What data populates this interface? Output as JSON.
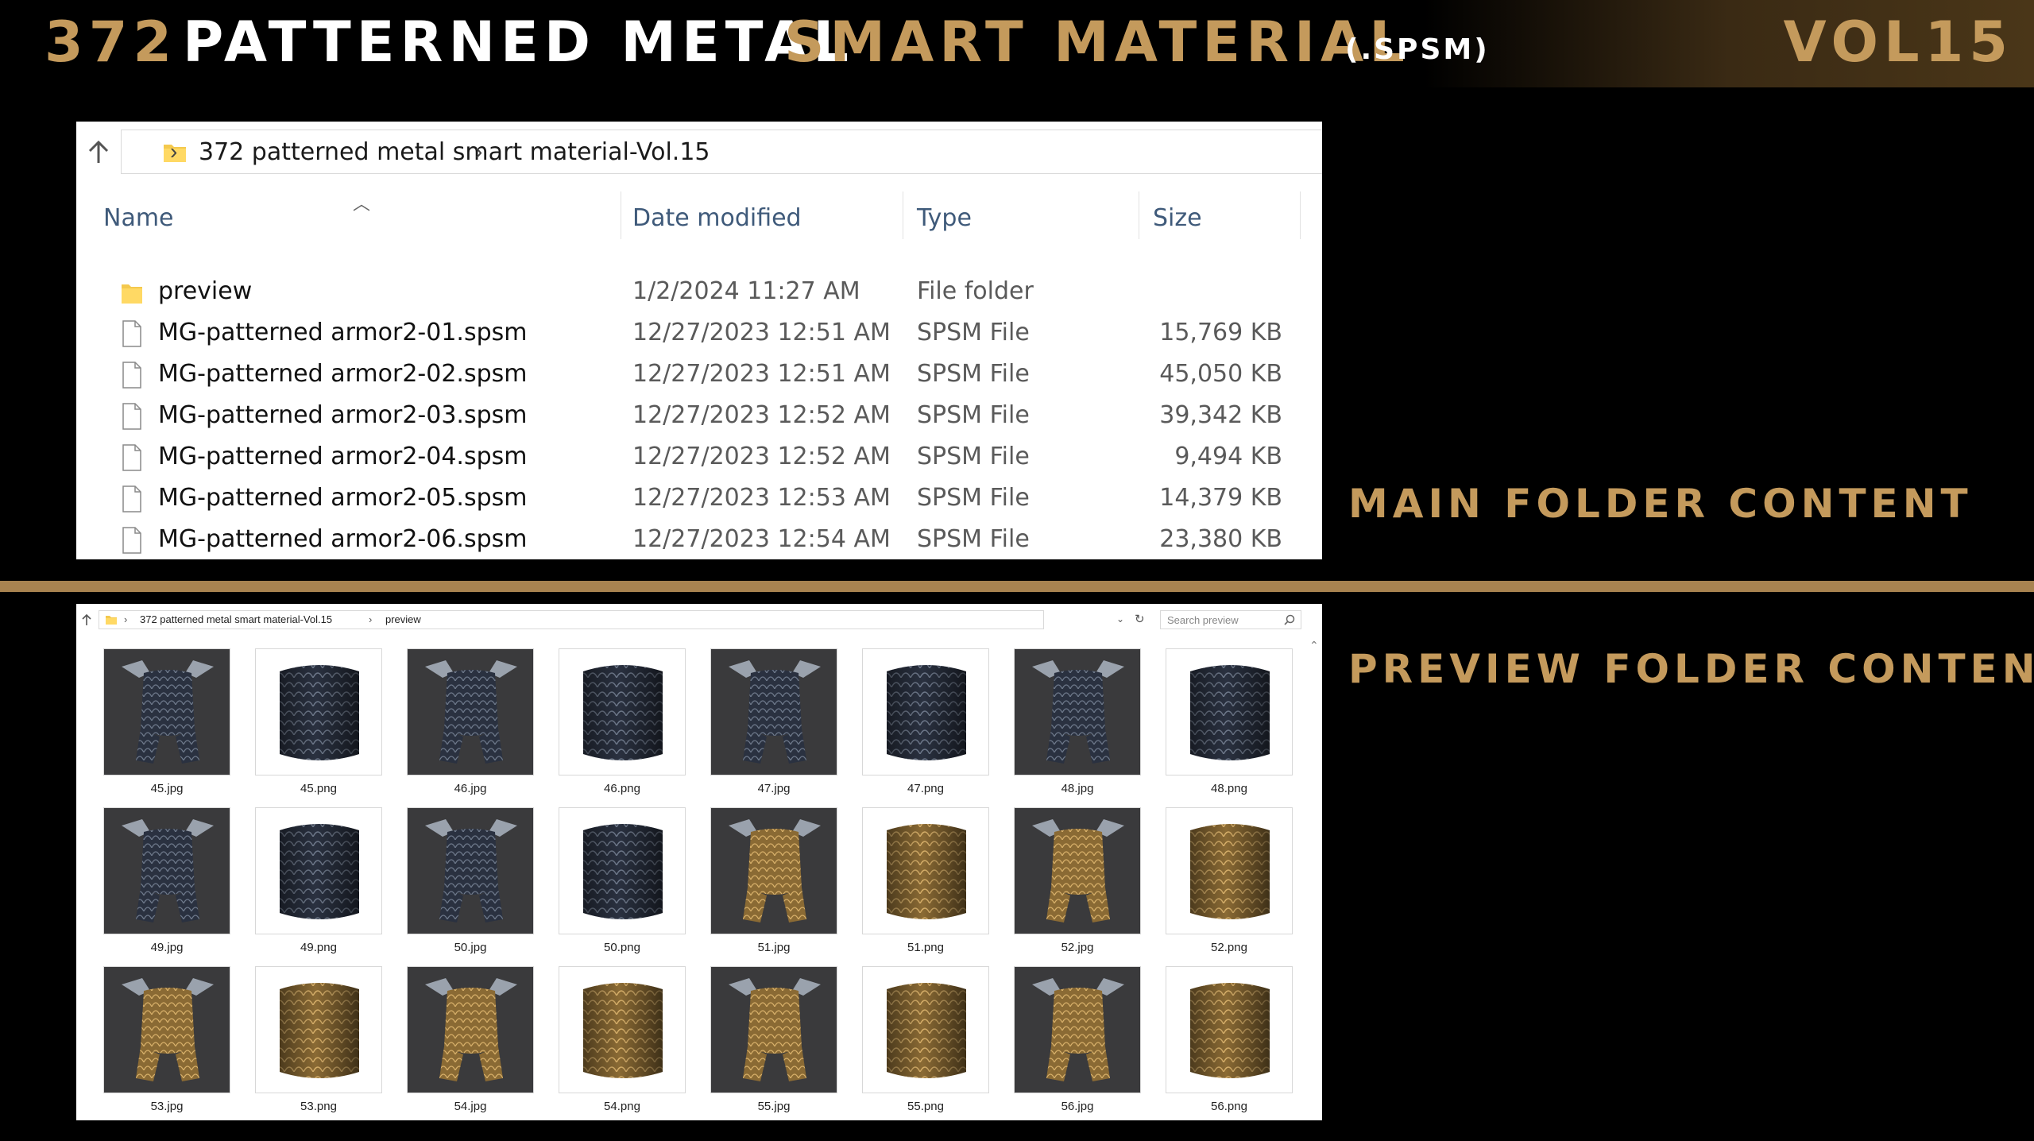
{
  "header": {
    "number": "372",
    "title_white": "PATTERNED METAL",
    "title_gold": "SMART MATERIAL",
    "extension": "(.SPSM)",
    "volume": "VOL15"
  },
  "labels": {
    "main": "MAIN FOLDER CONTENT",
    "preview": "PREVIEW FOLDER CONTENT"
  },
  "main_window": {
    "breadcrumb": "372 patterned metal smart material-Vol.15",
    "columns": {
      "name": "Name",
      "date": "Date modified",
      "type": "Type",
      "size": "Size"
    },
    "files": [
      {
        "name": "preview",
        "date": "1/2/2024 11:27 AM",
        "type": "File folder",
        "size": "",
        "icon": "folder-icon"
      },
      {
        "name": "MG-patterned armor2-01.spsm",
        "date": "12/27/2023 12:51 AM",
        "type": "SPSM File",
        "size": "15,769 KB",
        "icon": "file-icon"
      },
      {
        "name": "MG-patterned armor2-02.spsm",
        "date": "12/27/2023 12:51 AM",
        "type": "SPSM File",
        "size": "45,050 KB",
        "icon": "file-icon"
      },
      {
        "name": "MG-patterned armor2-03.spsm",
        "date": "12/27/2023 12:52 AM",
        "type": "SPSM File",
        "size": "39,342 KB",
        "icon": "file-icon"
      },
      {
        "name": "MG-patterned armor2-04.spsm",
        "date": "12/27/2023 12:52 AM",
        "type": "SPSM File",
        "size": "9,494 KB",
        "icon": "file-icon"
      },
      {
        "name": "MG-patterned armor2-05.spsm",
        "date": "12/27/2023 12:53 AM",
        "type": "SPSM File",
        "size": "14,379 KB",
        "icon": "file-icon"
      },
      {
        "name": "MG-patterned armor2-06.spsm",
        "date": "12/27/2023 12:54 AM",
        "type": "SPSM File",
        "size": "23,380 KB",
        "icon": "file-icon"
      }
    ]
  },
  "preview_window": {
    "breadcrumb_root": "372 patterned metal smart material-Vol.15",
    "breadcrumb_sub": "preview",
    "search_placeholder": "Search preview",
    "thumbnails": [
      {
        "label": "45.jpg",
        "kind": "armor",
        "tone": "dark"
      },
      {
        "label": "45.png",
        "kind": "cylinder",
        "tone": "dark"
      },
      {
        "label": "46.jpg",
        "kind": "armor",
        "tone": "dark"
      },
      {
        "label": "46.png",
        "kind": "cylinder",
        "tone": "dark"
      },
      {
        "label": "47.jpg",
        "kind": "armor",
        "tone": "dark"
      },
      {
        "label": "47.png",
        "kind": "cylinder",
        "tone": "dark"
      },
      {
        "label": "48.jpg",
        "kind": "armor",
        "tone": "dark"
      },
      {
        "label": "48.png",
        "kind": "cylinder",
        "tone": "dark"
      },
      {
        "label": "49.jpg",
        "kind": "armor",
        "tone": "dark"
      },
      {
        "label": "49.png",
        "kind": "cylinder",
        "tone": "dark"
      },
      {
        "label": "50.jpg",
        "kind": "armor",
        "tone": "dark"
      },
      {
        "label": "50.png",
        "kind": "cylinder",
        "tone": "dark"
      },
      {
        "label": "51.jpg",
        "kind": "armor",
        "tone": "gold"
      },
      {
        "label": "51.png",
        "kind": "cylinder",
        "tone": "gold"
      },
      {
        "label": "52.jpg",
        "kind": "armor",
        "tone": "gold"
      },
      {
        "label": "52.png",
        "kind": "cylinder",
        "tone": "gold"
      },
      {
        "label": "53.jpg",
        "kind": "armor",
        "tone": "gold"
      },
      {
        "label": "53.png",
        "kind": "cylinder",
        "tone": "gold"
      },
      {
        "label": "54.jpg",
        "kind": "armor",
        "tone": "gold"
      },
      {
        "label": "54.png",
        "kind": "cylinder",
        "tone": "gold"
      },
      {
        "label": "55.jpg",
        "kind": "armor",
        "tone": "gold"
      },
      {
        "label": "55.png",
        "kind": "cylinder",
        "tone": "gold"
      },
      {
        "label": "56.jpg",
        "kind": "armor",
        "tone": "gold"
      },
      {
        "label": "56.png",
        "kind": "cylinder",
        "tone": "gold"
      }
    ]
  },
  "colors": {
    "gold": "#c49a5c",
    "divider": "#a88350",
    "dark_metal": "#2a3140",
    "gold_metal": "#8a6a34"
  }
}
